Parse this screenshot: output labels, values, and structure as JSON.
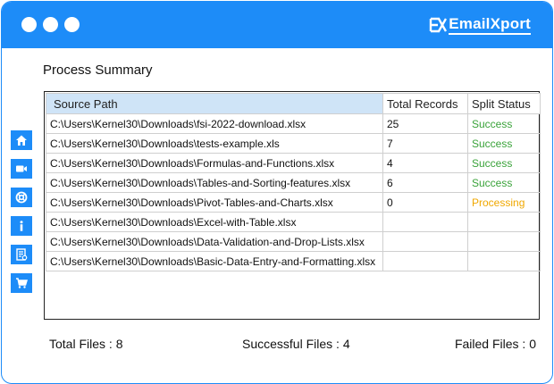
{
  "app": {
    "brand": "EmailXport"
  },
  "page": {
    "title": "Process Summary"
  },
  "sidebar": {
    "items": [
      {
        "icon": "home-icon"
      },
      {
        "icon": "video-icon"
      },
      {
        "icon": "support-icon"
      },
      {
        "icon": "info-icon"
      },
      {
        "icon": "license-icon"
      },
      {
        "icon": "cart-icon"
      }
    ]
  },
  "table": {
    "headers": {
      "path": "Source Path",
      "records": "Total Records",
      "status": "Split Status"
    },
    "rows": [
      {
        "path": "C:\\Users\\Kernel30\\Downloads\\fsi-2022-download.xlsx",
        "records": "25",
        "status": "Success"
      },
      {
        "path": "C:\\Users\\Kernel30\\Downloads\\tests-example.xls",
        "records": "7",
        "status": "Success"
      },
      {
        "path": "C:\\Users\\Kernel30\\Downloads\\Formulas-and-Functions.xlsx",
        "records": "4",
        "status": "Success"
      },
      {
        "path": "C:\\Users\\Kernel30\\Downloads\\Tables-and-Sorting-features.xlsx",
        "records": "6",
        "status": "Success"
      },
      {
        "path": "C:\\Users\\Kernel30\\Downloads\\Pivot-Tables-and-Charts.xlsx",
        "records": "0",
        "status": "Processing"
      },
      {
        "path": "C:\\Users\\Kernel30\\Downloads\\Excel-with-Table.xlsx",
        "records": "",
        "status": ""
      },
      {
        "path": "C:\\Users\\Kernel30\\Downloads\\Data-Validation-and-Drop-Lists.xlsx",
        "records": "",
        "status": ""
      },
      {
        "path": "C:\\Users\\Kernel30\\Downloads\\Basic-Data-Entry-and-Formatting.xlsx",
        "records": "",
        "status": ""
      }
    ]
  },
  "summary": {
    "total": "Total Files : 8",
    "successful": "Successful Files : 4",
    "failed": "Failed Files : 0"
  },
  "colors": {
    "accent": "#1d8cf8",
    "success": "#3aa33a",
    "processing": "#f0a800",
    "header_highlight": "#cfe4f7"
  }
}
